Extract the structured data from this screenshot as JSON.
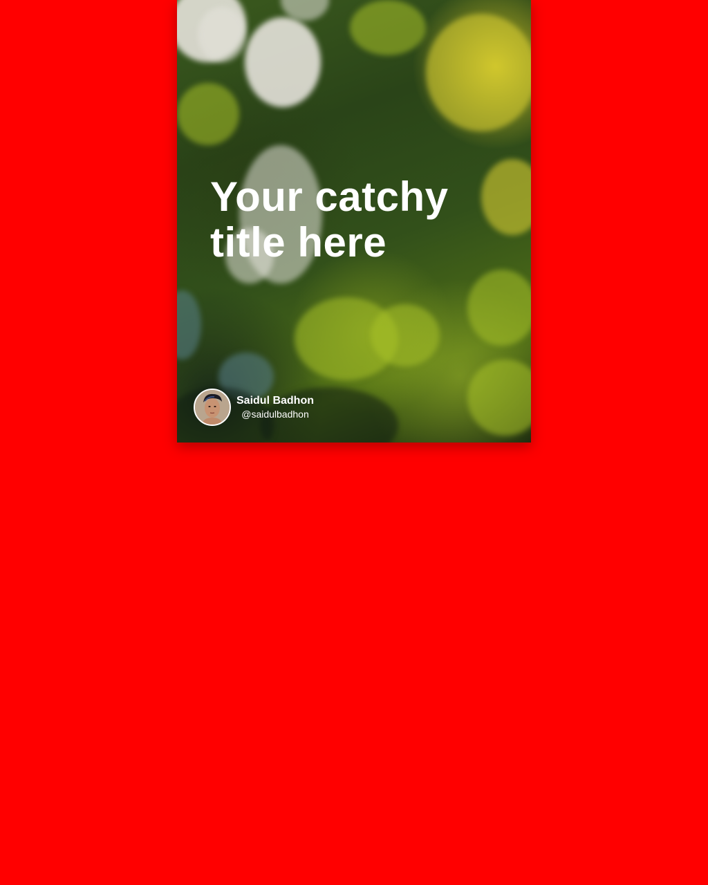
{
  "card": {
    "title": "Your catchy title here",
    "author": {
      "name": "Saidul Badhon",
      "handle": "@saidulbadhon"
    }
  },
  "colors": {
    "background": "#ff0000",
    "text": "#ffffff"
  },
  "icons": {
    "avatar": "profile-photo"
  }
}
